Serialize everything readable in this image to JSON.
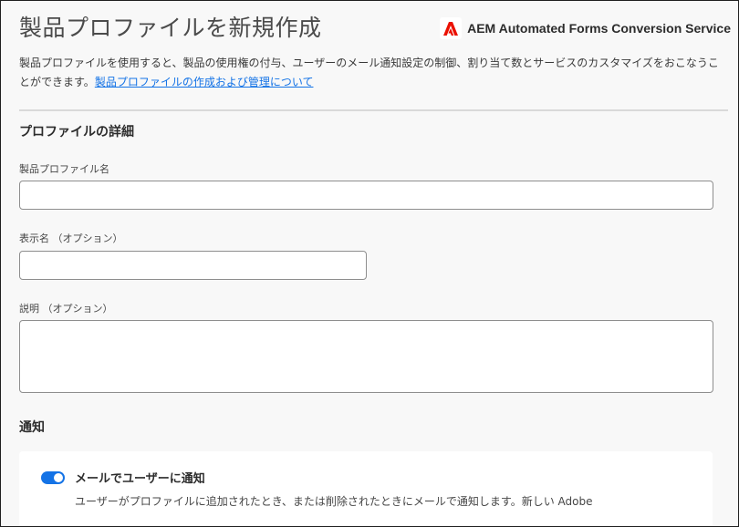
{
  "header": {
    "title": "製品プロファイルを新規作成",
    "service_name": "AEM Automated Forms Conversion Service",
    "logo_icon": "adobe-logo-icon",
    "logo_color": "#eb1000"
  },
  "intro": {
    "text": "製品プロファイルを使用すると、製品の使用権の付与、ユーザーのメール通知設定の制御、割り当て数とサービスのカスタマイズをおこなうことができます。",
    "link_text": "製品プロファイルの作成および管理について"
  },
  "details_section": {
    "title": "プロファイルの詳細",
    "profile_name": {
      "label": "製品プロファイル名",
      "value": "",
      "placeholder": ""
    },
    "display_name": {
      "label": "表示名 （オプション）",
      "value": "",
      "placeholder": ""
    },
    "description": {
      "label": "説明 （オプション）",
      "value": "",
      "placeholder": ""
    }
  },
  "notification_section": {
    "title": "通知",
    "email_toggle": {
      "label": "メールでユーザーに通知",
      "enabled": true,
      "description": "ユーザーがプロファイルに追加されたとき、または削除されたときにメールで通知します。新しい Adobe"
    }
  },
  "colors": {
    "accent": "#1473e6",
    "background": "#f8f8f8"
  }
}
